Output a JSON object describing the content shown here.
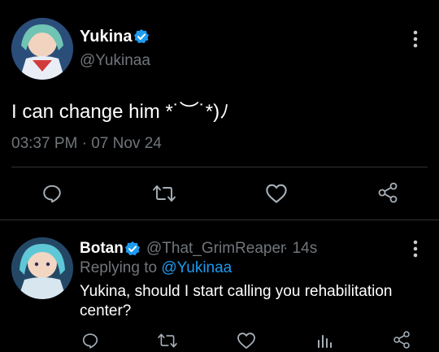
{
  "main_tweet": {
    "author_name": "Yukina",
    "handle": "@Yukinaa",
    "text": "I can change him *˙︶˙*)ﾉ",
    "timestamp": "03:37 PM · 07 Nov 24",
    "verified_icon": "verified-badge-icon",
    "actions": [
      "reply-icon",
      "retweet-icon",
      "like-icon",
      "share-icon"
    ]
  },
  "reply": {
    "author_name": "Botan",
    "handle": "@That_GrimReaper",
    "time_ago": "· 14s",
    "replying_prefix": "Replying to",
    "replying_to": "@Yukinaa",
    "text_line1": "Yukina, should I start calling you rehabilitation",
    "text_line2": "center?",
    "actions": [
      "reply-icon",
      "retweet-icon",
      "like-icon",
      "stats-icon",
      "share-icon"
    ]
  },
  "colors": {
    "background": "#000000",
    "text": "#ffffff",
    "muted": "#71767b",
    "accent": "#1d9bf0",
    "divider": "#2f3336"
  }
}
